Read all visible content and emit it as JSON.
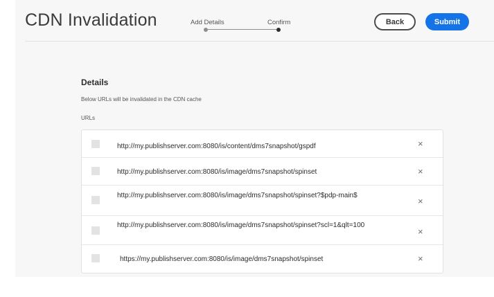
{
  "header": {
    "title": "CDN Invalidation",
    "steps": [
      {
        "label": "Add Details",
        "state": "completed"
      },
      {
        "label": "Confirm",
        "state": "current"
      }
    ],
    "back_label": "Back",
    "submit_label": "Submit"
  },
  "details": {
    "title": "Details",
    "description": "Below URLs will be invalidated in the CDN cache",
    "urls_label": "URLs"
  },
  "urls": [
    {
      "text": "http://my.publishserver.com:8080/is/content/dms7snapshot/gspdf",
      "remove_icon": "close-icon"
    },
    {
      "text": "http://my.publishserver.com:8080/is/image/dms7snapshot/spinset",
      "remove_icon": "close-icon"
    },
    {
      "text": "http://my.publishserver.com:8080/is/image/dms7snapshot/spinset?$pdp-main$",
      "remove_icon": "close-icon"
    },
    {
      "text": "http://my.publishserver.com:8080/is/image/dms7snapshot/spinset?scl=1&qlt=100",
      "remove_icon": "close-icon"
    },
    {
      "text": "https://my.publishserver.com:8080/is/image/dms7snapshot/spinset",
      "remove_icon": "close-icon"
    }
  ],
  "colors": {
    "accent": "#1473e6",
    "panel_background": "#f7f7f7",
    "checkbox": "#e3e3e3"
  }
}
